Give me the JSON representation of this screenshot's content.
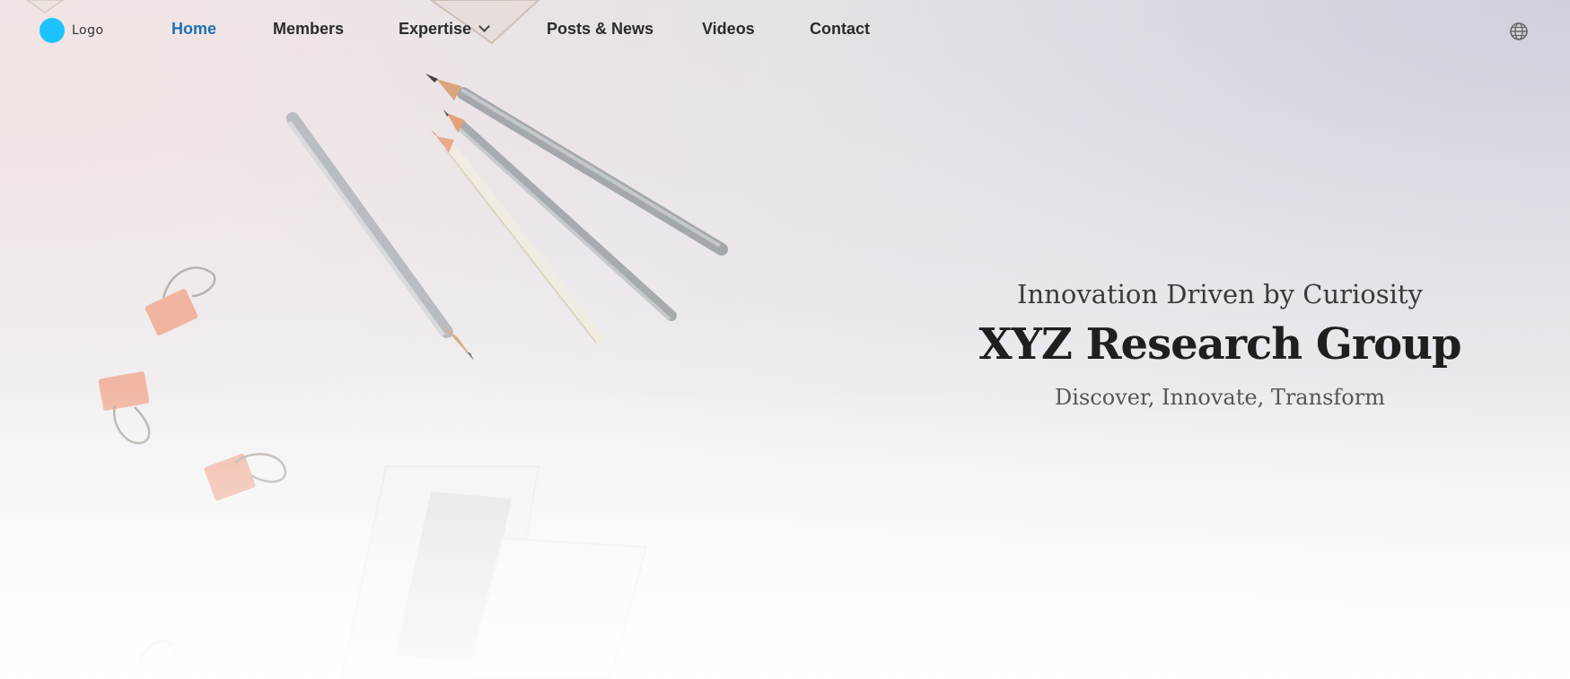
{
  "navbar": {
    "logo_text": "Logo",
    "items": [
      {
        "label": "Home",
        "active": true
      },
      {
        "label": "Members"
      },
      {
        "label": "Expertise",
        "has_dropdown": true
      },
      {
        "label": "Posts & News"
      },
      {
        "label": "Videos"
      },
      {
        "label": "Contact"
      }
    ],
    "language_icon": "globe-icon"
  },
  "hero": {
    "tagline": "Innovation Driven by Curiosity",
    "title": "XYZ Research Group",
    "subtitle": "Discover, Innovate, Transform"
  },
  "colors": {
    "accent": "#1f6fb2",
    "logo": "#1cc3ff",
    "text_dark": "#1f1f1f"
  }
}
